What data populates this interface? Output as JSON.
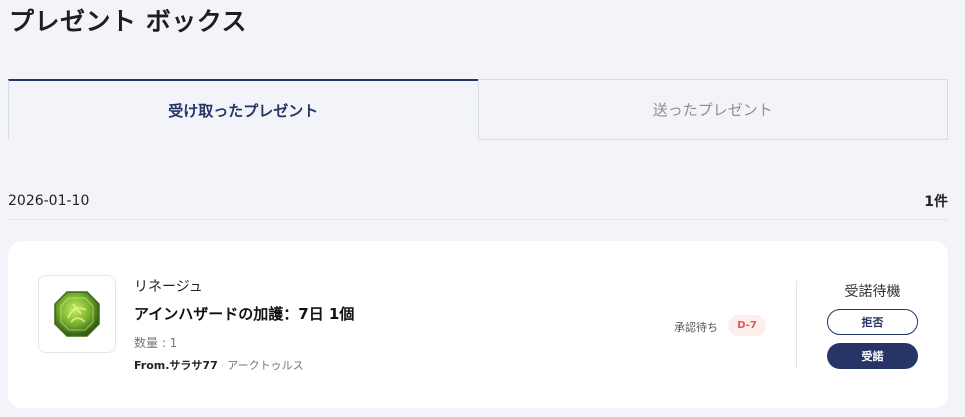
{
  "page": {
    "title": "プレゼント ボックス"
  },
  "tabs": [
    {
      "label": "受け取ったプレゼント",
      "active": true
    },
    {
      "label": "送ったプレゼント",
      "active": false
    }
  ],
  "date_group": {
    "date": "2026-01-10",
    "count": "1件"
  },
  "gift": {
    "icon": "green-gem-icon",
    "game": "リネージュ",
    "item_name": "アインハザードの加護：7日 1個",
    "quantity": "数量 : 1",
    "sender": "From.サラサ77",
    "separator": "·",
    "server": "アークトゥルス",
    "status": "承認待ち",
    "deadline": "D-7"
  },
  "actions": {
    "title": "受諾待機",
    "reject_label": "拒否",
    "accept_label": "受諾"
  },
  "colors": {
    "accent": "#263566",
    "background": "#f3f4f9",
    "deadline": "#e0564e",
    "gem": "#7bb432"
  }
}
